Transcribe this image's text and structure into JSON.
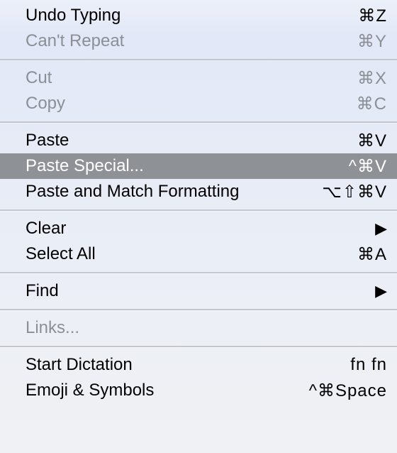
{
  "menu": {
    "sections": [
      [
        {
          "id": "undo",
          "label": "Undo Typing",
          "shortcut": "⌘Z",
          "disabled": false,
          "submenu": false
        },
        {
          "id": "repeat",
          "label": "Can't Repeat",
          "shortcut": "⌘Y",
          "disabled": true,
          "submenu": false
        }
      ],
      [
        {
          "id": "cut",
          "label": "Cut",
          "shortcut": "⌘X",
          "disabled": true,
          "submenu": false
        },
        {
          "id": "copy",
          "label": "Copy",
          "shortcut": "⌘C",
          "disabled": true,
          "submenu": false
        }
      ],
      [
        {
          "id": "paste",
          "label": "Paste",
          "shortcut": "⌘V",
          "disabled": false,
          "submenu": false
        },
        {
          "id": "paste-special",
          "label": "Paste Special...",
          "shortcut": "^⌘V",
          "disabled": false,
          "submenu": false,
          "selected": true
        },
        {
          "id": "paste-match",
          "label": "Paste and Match Formatting",
          "shortcut": "⌥⇧⌘V",
          "disabled": false,
          "submenu": false
        }
      ],
      [
        {
          "id": "clear",
          "label": "Clear",
          "shortcut": "",
          "disabled": false,
          "submenu": true
        },
        {
          "id": "select-all",
          "label": "Select All",
          "shortcut": "⌘A",
          "disabled": false,
          "submenu": false
        }
      ],
      [
        {
          "id": "find",
          "label": "Find",
          "shortcut": "",
          "disabled": false,
          "submenu": true
        }
      ],
      [
        {
          "id": "links",
          "label": "Links...",
          "shortcut": "",
          "disabled": true,
          "submenu": false
        }
      ],
      [
        {
          "id": "dictation",
          "label": "Start Dictation",
          "shortcut": "fn fn",
          "disabled": false,
          "submenu": false
        },
        {
          "id": "emoji",
          "label": "Emoji & Symbols",
          "shortcut": "^⌘Space",
          "disabled": false,
          "submenu": false
        }
      ]
    ]
  }
}
